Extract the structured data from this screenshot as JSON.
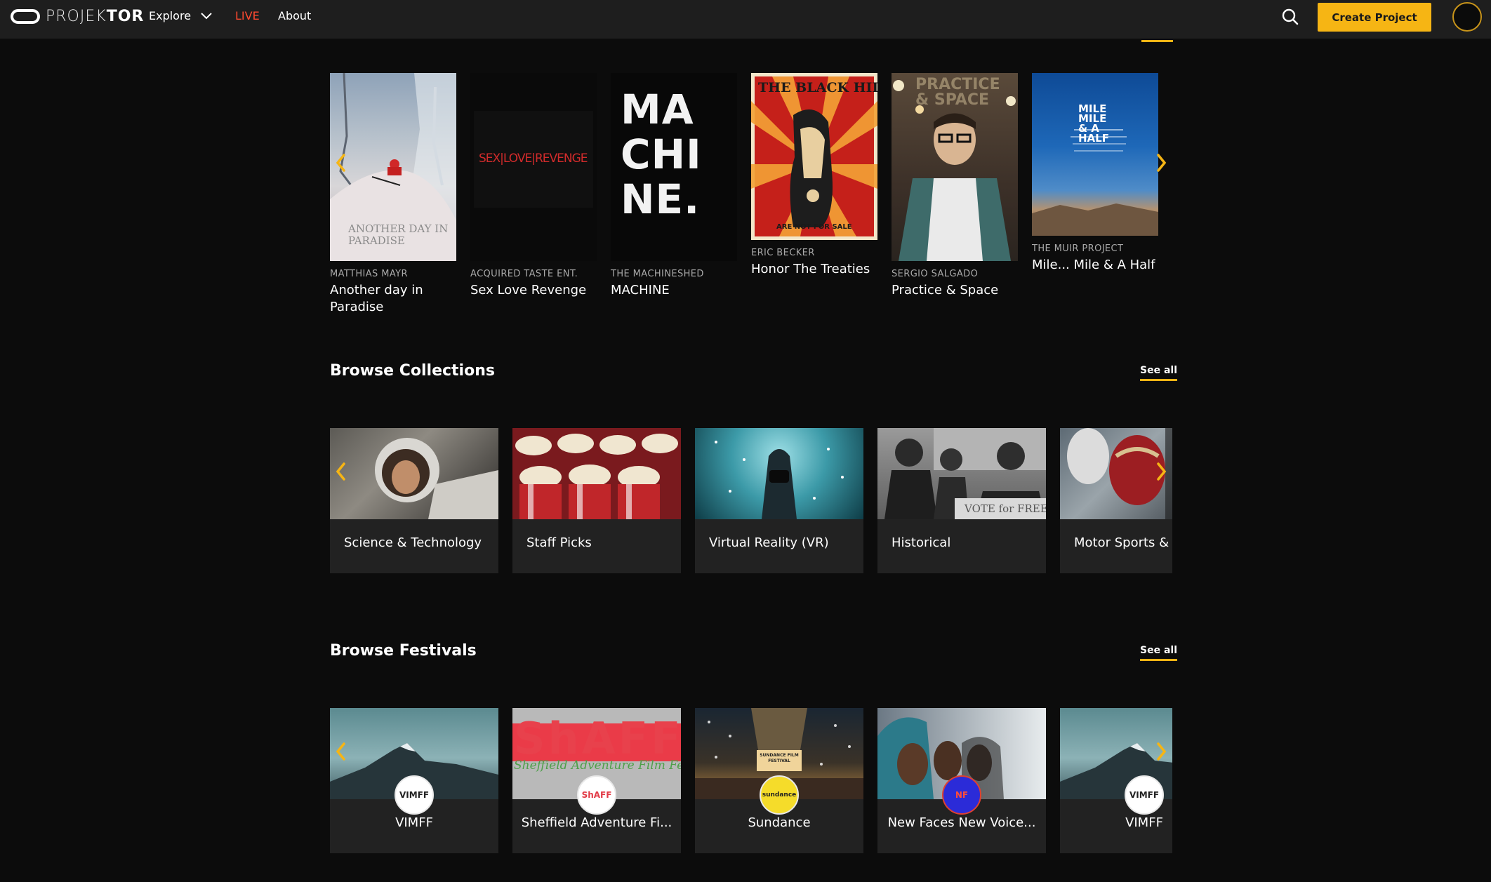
{
  "nav": {
    "logo_prefix": "PROJEK",
    "logo_suffix": "TOR",
    "explore": "Explore",
    "live": "LIVE",
    "about": "About",
    "create_project": "Create Project",
    "icons": [
      "logo-icon",
      "chevron-down-icon",
      "search-icon",
      "avatar"
    ]
  },
  "films": [
    {
      "owner": "MATTHIAS MAYR",
      "title": "Another day in Paradise",
      "poster_text": "ANOTHER DAY IN PARADISE"
    },
    {
      "owner": "ACQUIRED TASTE ENT.",
      "title": "Sex Love Revenge",
      "poster_text": "SEX|LOVE|REVENGE"
    },
    {
      "owner": "THE MACHINESHED",
      "title": "MACHINE",
      "poster_text": "MA CHI NE."
    },
    {
      "owner": "ERIC BECKER",
      "title": "Honor The Treaties",
      "poster_text": "THE BLACK HILLS",
      "poster_subtext": "ARE NOT FOR SALE"
    },
    {
      "owner": "SERGIO SALGADO",
      "title": "Practice & Space",
      "poster_text": "PRACTICE & SPACE"
    },
    {
      "owner": "THE MUIR PROJECT",
      "title": "Mile... Mile & A Half",
      "poster_text": "MILE MILE & A HALF"
    }
  ],
  "collections": {
    "title": "Browse Collections",
    "see_all": "See all",
    "items": [
      {
        "label": "Science & Technology"
      },
      {
        "label": "Staff Picks"
      },
      {
        "label": "Virtual Reality (VR)"
      },
      {
        "label": "Historical",
        "image_text": "VOTE for FREEDOM"
      },
      {
        "label": "Motor Sports & I"
      }
    ]
  },
  "festivals": {
    "title": "Browse Festivals",
    "see_all": "See all",
    "items": [
      {
        "label": "VIMFF",
        "logo_text": "VIMFF"
      },
      {
        "label": "Sheffield Adventure Fi...",
        "logo_text": "ShAFF",
        "banner_text": "ShAFF",
        "banner_subtext": "Sheffield Adventure Film Festival"
      },
      {
        "label": "Sundance",
        "logo_text": "sundance",
        "image_text": "SUNDANCE FILM FESTIVAL"
      },
      {
        "label": "New Faces New Voice...",
        "logo_text": "NF"
      },
      {
        "label": "VIMFF",
        "logo_text": "VIMFF"
      }
    ]
  },
  "colors": {
    "accent": "#f6b514",
    "live": "#ff4a30",
    "background": "#0c0c0c",
    "navbar": "#1e1e1e",
    "card": "#222222"
  }
}
